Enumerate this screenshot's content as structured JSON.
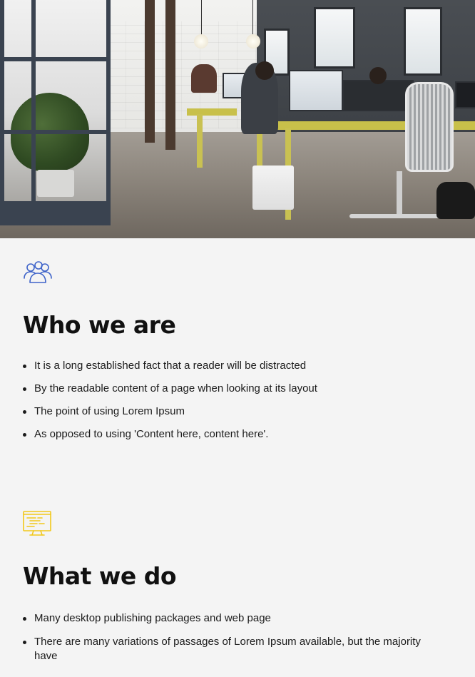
{
  "hero": {
    "image_description_icon": "office-photo"
  },
  "sections": [
    {
      "icon": "people-group-icon",
      "icon_color": "#3e63c9",
      "title": "Who we are",
      "items": [
        "It is a long established fact that a reader will be distracted",
        "By the readable content of a page when looking at its layout",
        "The point of using Lorem Ipsum",
        "As opposed to using 'Content here, content here'."
      ]
    },
    {
      "icon": "monitor-code-icon",
      "icon_color": "#f2c81b",
      "title": "What we do",
      "items": [
        "Many desktop publishing packages and web page",
        "There are many variations of passages of Lorem Ipsum available, but the majority have"
      ]
    }
  ]
}
